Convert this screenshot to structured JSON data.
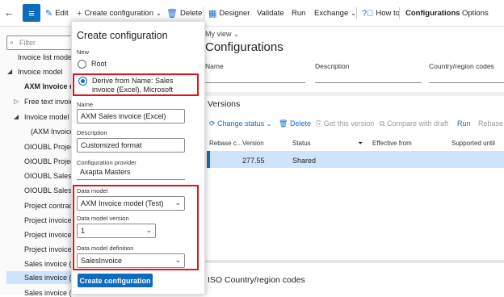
{
  "toolbar": {
    "edit": "Edit",
    "create_configuration": "Create configuration",
    "delete": "Delete",
    "designer": "Designer",
    "validate": "Validate",
    "run": "Run",
    "exchange": "Exchange",
    "how_to": "How to",
    "configurations": "Configurations",
    "options": "Options"
  },
  "tree": {
    "filter_placeholder": "Filter",
    "items": [
      "Invoice list mode",
      "Invoice model",
      "AXM Invoice m",
      "Free text invoic",
      "Invoice model r",
      "(AXM Invoice",
      "OIOUBL Project",
      "OIOUBL Project",
      "OIOUBL Sales c",
      "OIOUBL Sales i",
      "Project contract",
      "Project invoice",
      "Project invoice",
      "Project invoice",
      "Sales invoice (E",
      "Sales invoice (E",
      "Sales invoice (T"
    ]
  },
  "dialog": {
    "title": "Create configuration",
    "new_label": "New",
    "root_label": "Root",
    "derive_label": "Derive from Name: Sales invoice (Excel), Microsoft",
    "name_label": "Name",
    "name_value": "AXM Sales invoice (Excel)",
    "description_label": "Description",
    "description_value": "Customized format",
    "provider_label": "Configuration provider",
    "provider_value": "Axapta Masters",
    "data_model_label": "Data model",
    "data_model_value": "AXM Invoice model (Test)",
    "data_model_version_label": "Data model version",
    "data_model_version_value": "1",
    "data_model_definition_label": "Data model definition",
    "data_model_definition_value": "SalesInvoice",
    "create_button": "Create configuration"
  },
  "main": {
    "view_selector": "My view",
    "title": "Configurations",
    "columns": [
      "Name",
      "Description",
      "Country/region codes"
    ],
    "versions_title": "Versions",
    "versions_toolbar": {
      "change_status": "Change status",
      "delete": "Delete",
      "get_this_version": "Get this version",
      "compare_with_draft": "Compare with draft",
      "run": "Run",
      "rebase": "Rebase"
    },
    "grid_headers": [
      "Rebase c...",
      "Version",
      "Status",
      "Effective from",
      "Supported until"
    ],
    "grid_row": {
      "version": "277.55",
      "status": "Shared"
    },
    "iso_title": "ISO Country/region codes"
  },
  "colors": {
    "accent": "#0f6cbd",
    "highlight": "#e0141e",
    "selection": "#cfe4fa"
  }
}
